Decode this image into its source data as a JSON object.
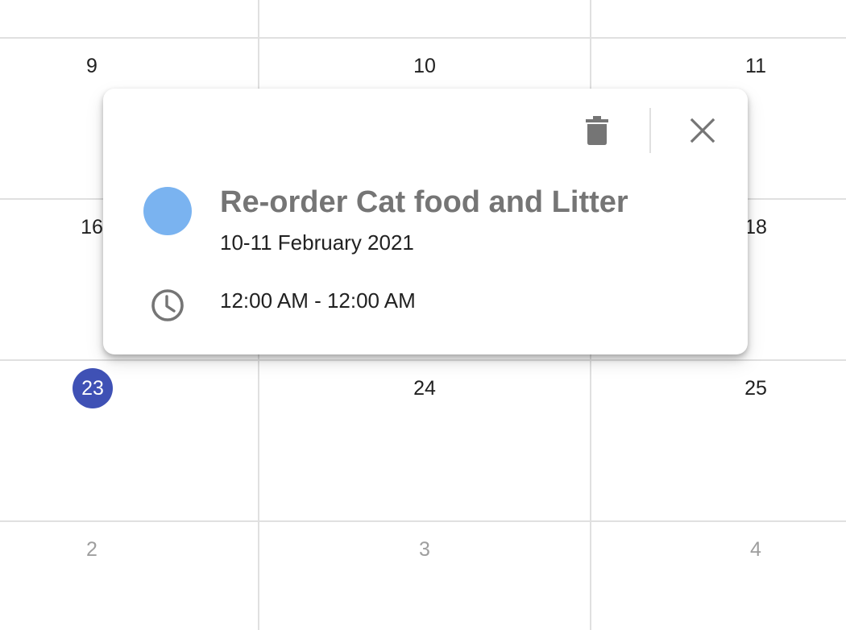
{
  "calendar": {
    "weeks": [
      {
        "days": [
          "9",
          "10",
          "11"
        ]
      },
      {
        "days": [
          "16",
          "",
          "18"
        ]
      },
      {
        "days": [
          "23",
          "24",
          "25"
        ]
      },
      {
        "days": [
          "2",
          "3",
          "4"
        ]
      }
    ],
    "today_color": "#3f51b5"
  },
  "popover": {
    "title": "Re-order Cat food and Litter",
    "date_range": "10-11 February 2021",
    "time_range": "12:00 AM - 12:00 AM",
    "event_color": "#7ab3f0",
    "icons": {
      "delete": "trash-icon",
      "close": "close-icon",
      "time": "clock-icon"
    }
  }
}
